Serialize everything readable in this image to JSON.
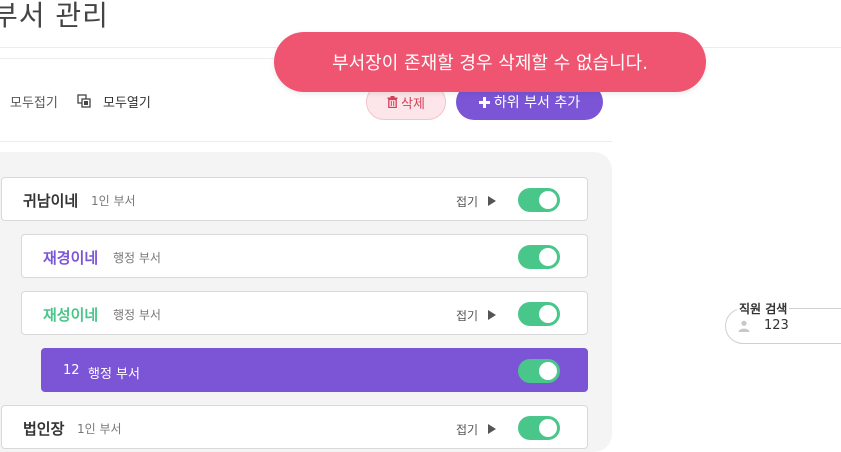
{
  "header": {
    "title": "부서 관리"
  },
  "toolbar": {
    "collapse_all": "모두접기",
    "expand_all": "모두열기",
    "delete_label": "삭제",
    "add_label": "하위 부서 추가"
  },
  "toast": {
    "message": "부서장이 존재할 경우 삭제할 수 없습니다."
  },
  "tree": {
    "fold_label": "접기",
    "items": [
      {
        "name": "귀남이네",
        "type": "1인 부서",
        "name_color": "#333333",
        "has_fold": true,
        "enabled": true
      },
      {
        "name": "재경이네",
        "type": "행정 부서",
        "name_color": "#7b55d6",
        "has_fold": false,
        "enabled": true
      },
      {
        "name": "재성이네",
        "type": "행정 부서",
        "name_color": "#49c68a",
        "has_fold": true,
        "enabled": true
      },
      {
        "name": "12",
        "type": "행정 부서",
        "selected": true,
        "has_fold": false,
        "enabled": true
      },
      {
        "name": "법인장",
        "type": "1인 부서",
        "name_color": "#333333",
        "has_fold": true,
        "enabled": true
      }
    ]
  },
  "search": {
    "label": "직원 검색",
    "value": "123"
  },
  "colors": {
    "accent": "#7b55d6",
    "toggle_on": "#49c68a",
    "toast": "#ef5470",
    "delete": "#d53f5a"
  }
}
